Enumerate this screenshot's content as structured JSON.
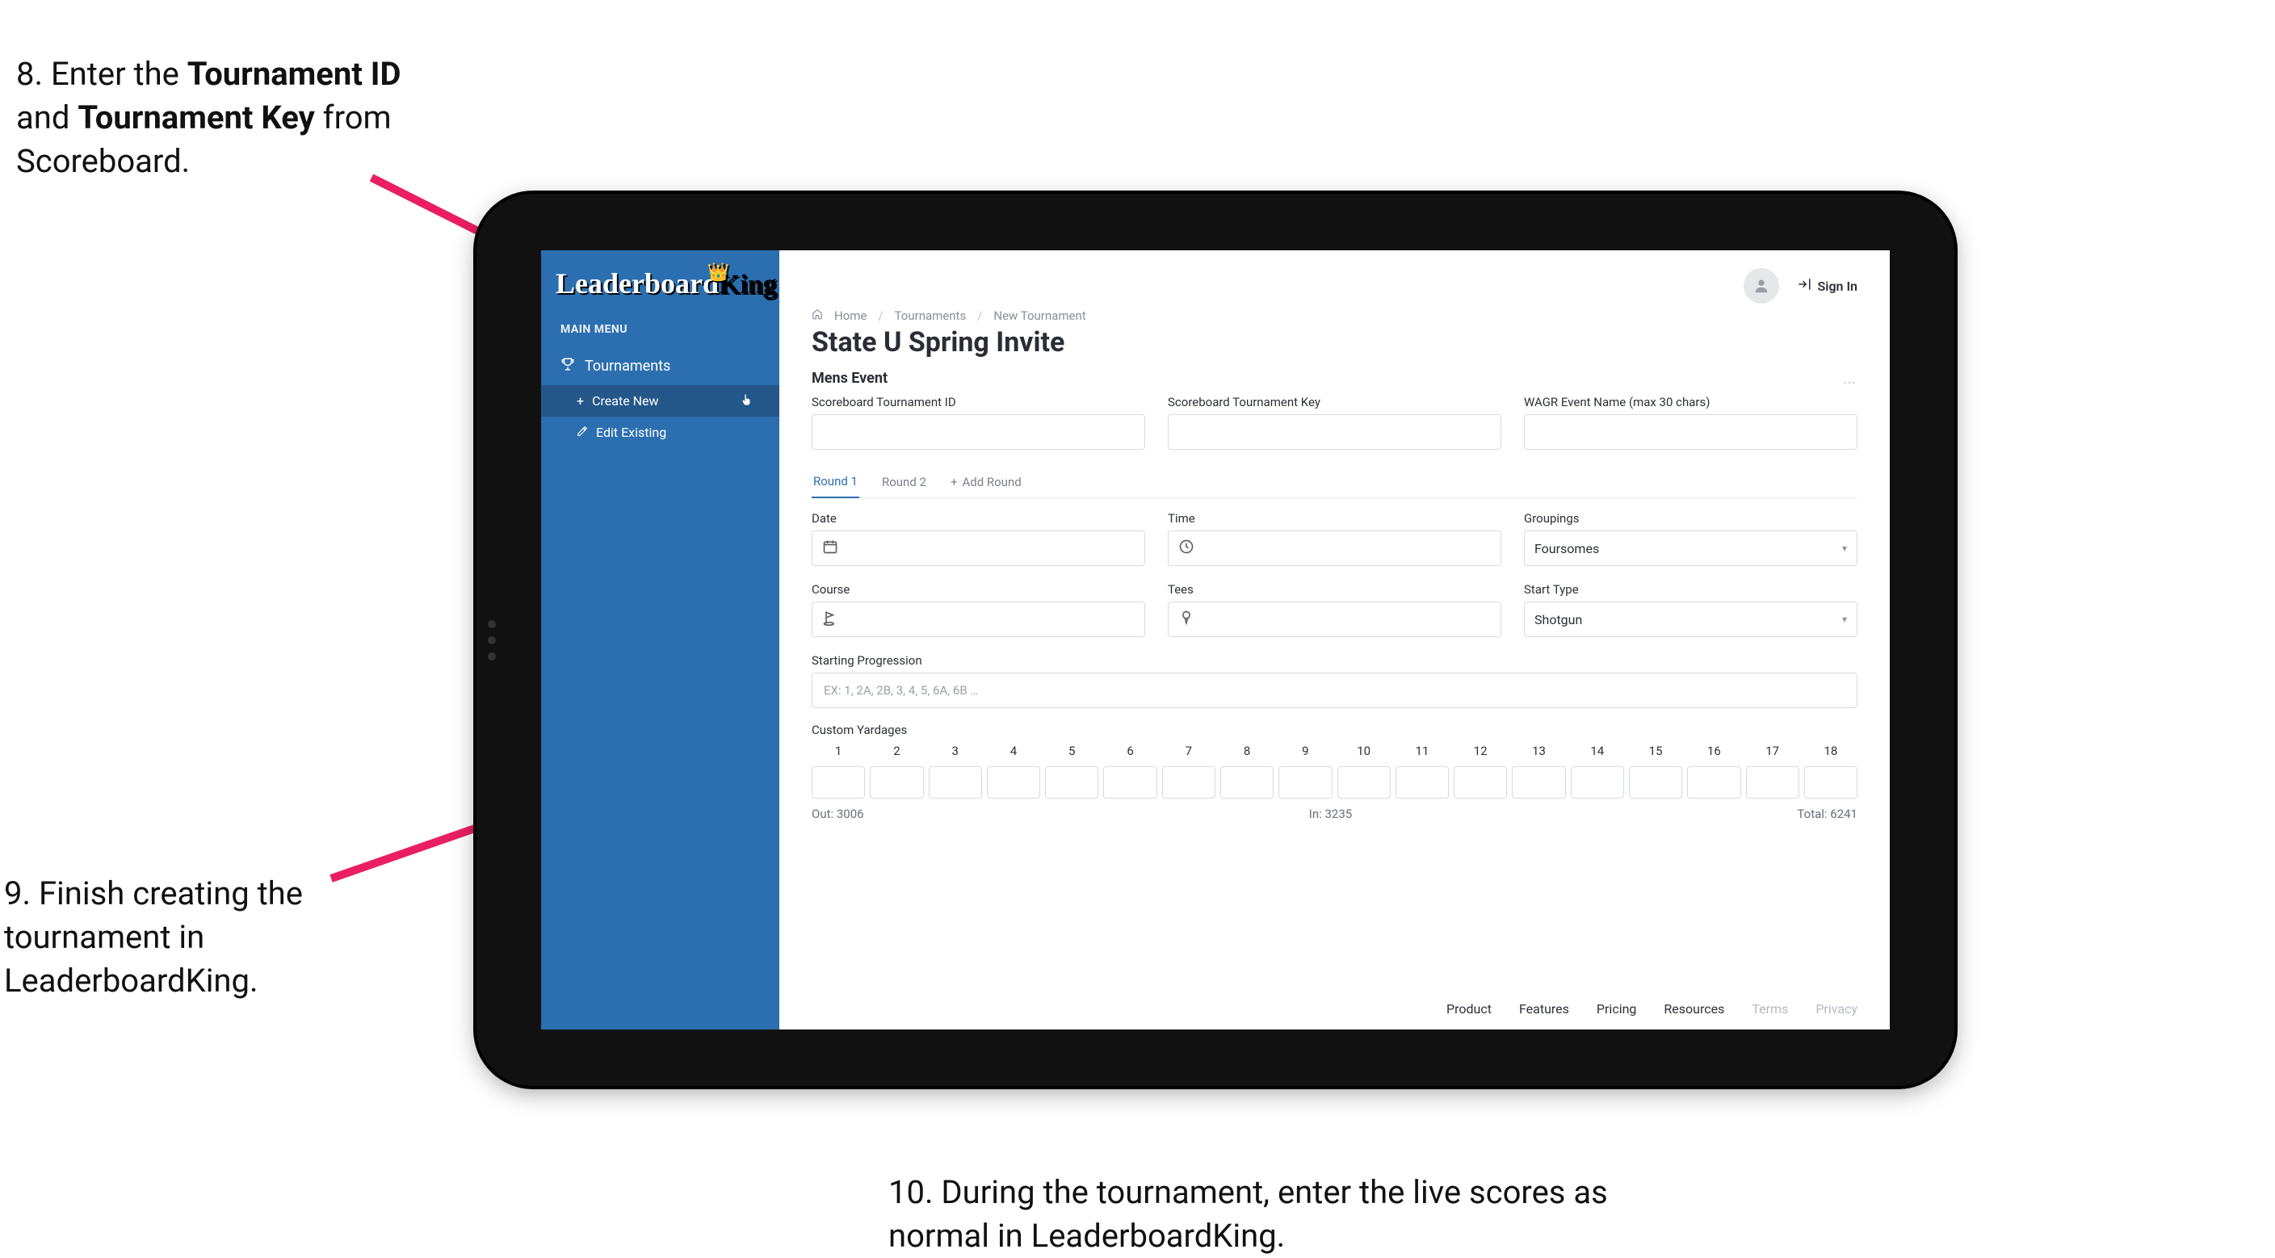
{
  "steps": {
    "s8_pre": "8. Enter the ",
    "s8_b1": "Tournament ID",
    "s8_mid": " and ",
    "s8_b2": "Tournament Key",
    "s8_post": " from Scoreboard.",
    "s9": "9. Finish creating the tournament in LeaderboardKing.",
    "s10": "10. During the tournament, enter the live scores as normal in LeaderboardKing."
  },
  "sidebar": {
    "logo": "Leaderboard",
    "logo_sub": "King",
    "main_menu": "MAIN MENU",
    "tournaments": "Tournaments",
    "create_new": "Create New",
    "edit_existing": "Edit Existing"
  },
  "topbar": {
    "sign_in": "Sign In"
  },
  "breadcrumb": {
    "home": "Home",
    "tournaments": "Tournaments",
    "new_tournament": "New Tournament"
  },
  "page": {
    "title": "State U Spring Invite",
    "section_title": "Mens Event"
  },
  "fields": {
    "scoreboard_id": "Scoreboard Tournament ID",
    "scoreboard_key": "Scoreboard Tournament Key",
    "wagr": "WAGR Event Name (max 30 chars)",
    "date": "Date",
    "time": "Time",
    "groupings": "Groupings",
    "course": "Course",
    "tees": "Tees",
    "start_type": "Start Type",
    "starting_progression": "Starting Progression",
    "starting_placeholder": "EX: 1, 2A, 2B, 3, 4, 5, 6A, 6B …",
    "custom_yardages": "Custom Yardages"
  },
  "selects": {
    "groupings_value": "Foursomes",
    "start_type_value": "Shotgun"
  },
  "tabs": {
    "round1": "Round 1",
    "round2": "Round 2",
    "add_round": "Add Round"
  },
  "holes": [
    "1",
    "2",
    "3",
    "4",
    "5",
    "6",
    "7",
    "8",
    "9",
    "10",
    "11",
    "12",
    "13",
    "14",
    "15",
    "16",
    "17",
    "18"
  ],
  "totals": {
    "out": "Out: 3006",
    "in": "In: 3235",
    "total": "Total: 6241"
  },
  "footer": {
    "product": "Product",
    "features": "Features",
    "pricing": "Pricing",
    "resources": "Resources",
    "terms": "Terms",
    "privacy": "Privacy"
  },
  "colors": {
    "accent": "#e91e63",
    "sidebar": "#2b6fb0"
  }
}
